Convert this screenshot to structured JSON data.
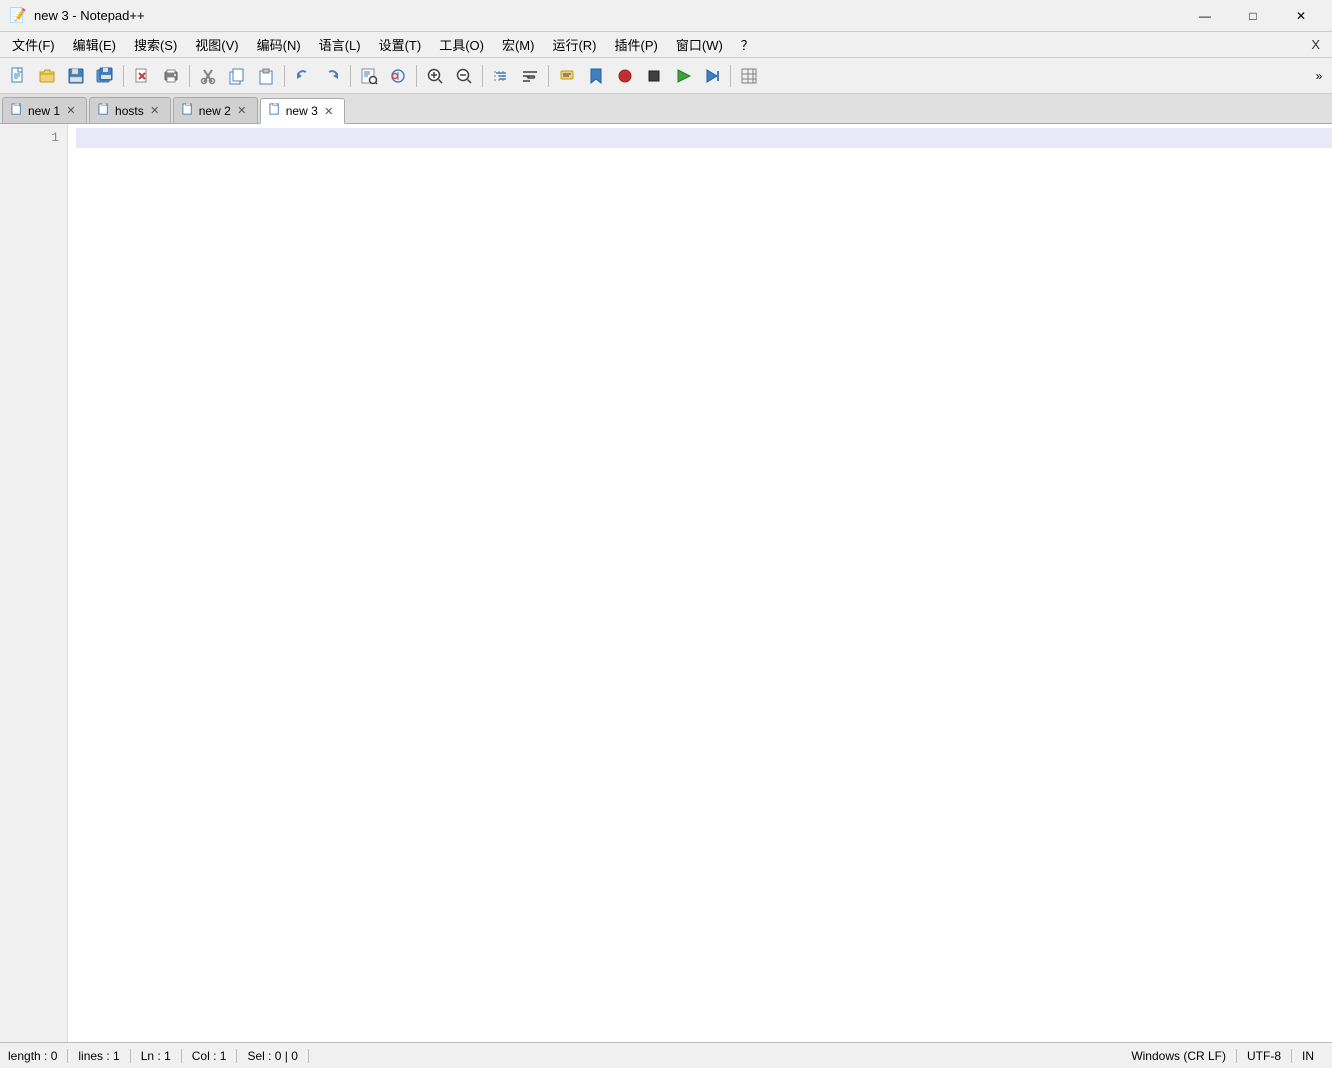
{
  "titleBar": {
    "title": "new 3 - Notepad++",
    "appIcon": "📝",
    "minimizeLabel": "—",
    "maximizeLabel": "□",
    "closeLabel": "✕"
  },
  "menuBar": {
    "items": [
      {
        "label": "文件(F)"
      },
      {
        "label": "编辑(E)"
      },
      {
        "label": "搜索(S)"
      },
      {
        "label": "视图(V)"
      },
      {
        "label": "编码(N)"
      },
      {
        "label": "语言(L)"
      },
      {
        "label": "设置(T)"
      },
      {
        "label": "工具(O)"
      },
      {
        "label": "宏(M)"
      },
      {
        "label": "运行(R)"
      },
      {
        "label": "插件(P)"
      },
      {
        "label": "窗口(W)"
      },
      {
        "label": "？"
      }
    ],
    "overflowLabel": "X"
  },
  "toolbar": {
    "buttons": [
      {
        "name": "new-file-btn",
        "icon": "📄"
      },
      {
        "name": "open-file-btn",
        "icon": "📂"
      },
      {
        "name": "save-btn",
        "icon": "💾"
      },
      {
        "name": "save-all-btn",
        "icon": "💾"
      },
      {
        "name": "close-btn",
        "icon": "📋"
      },
      {
        "name": "print-btn",
        "icon": "🖨"
      },
      {
        "name": "cut-btn",
        "icon": "✂"
      },
      {
        "name": "copy-btn",
        "icon": "📋"
      },
      {
        "name": "paste-btn",
        "icon": "📌"
      },
      {
        "name": "undo-btn",
        "icon": "↩"
      },
      {
        "name": "redo-btn",
        "icon": "↪"
      },
      {
        "name": "find-btn",
        "icon": "🔍"
      },
      {
        "name": "replace-btn",
        "icon": "🔄"
      },
      {
        "name": "zoom-in-btn",
        "icon": "🔎"
      },
      {
        "name": "zoom-out-btn",
        "icon": "🔍"
      },
      {
        "name": "indent-btn",
        "icon": "📐"
      },
      {
        "name": "dedent-btn",
        "icon": "⬅"
      },
      {
        "name": "bookmark-btn",
        "icon": "🔖"
      },
      {
        "name": "macro-btn",
        "icon": "⏺"
      },
      {
        "name": "run-btn",
        "icon": "▶"
      },
      {
        "name": "grid-btn",
        "icon": "⊞"
      }
    ],
    "overflowIcon": "»"
  },
  "tabs": [
    {
      "id": "tab1",
      "label": "new 1",
      "active": false,
      "icon": "💾"
    },
    {
      "id": "tab2",
      "label": "hosts",
      "active": false,
      "icon": "💾"
    },
    {
      "id": "tab3",
      "label": "new 2",
      "active": false,
      "icon": "💾"
    },
    {
      "id": "tab4",
      "label": "new 3",
      "active": true,
      "icon": "💾"
    }
  ],
  "editor": {
    "lines": [
      {
        "number": "1",
        "content": "",
        "active": true
      }
    ]
  },
  "statusBar": {
    "length": "length : 0",
    "lines": "lines : 1",
    "ln": "Ln : 1",
    "col": "Col : 1",
    "sel": "Sel : 0 | 0",
    "lineEnding": "Windows (CR LF)",
    "encoding": "UTF-8",
    "insertMode": "IN"
  }
}
